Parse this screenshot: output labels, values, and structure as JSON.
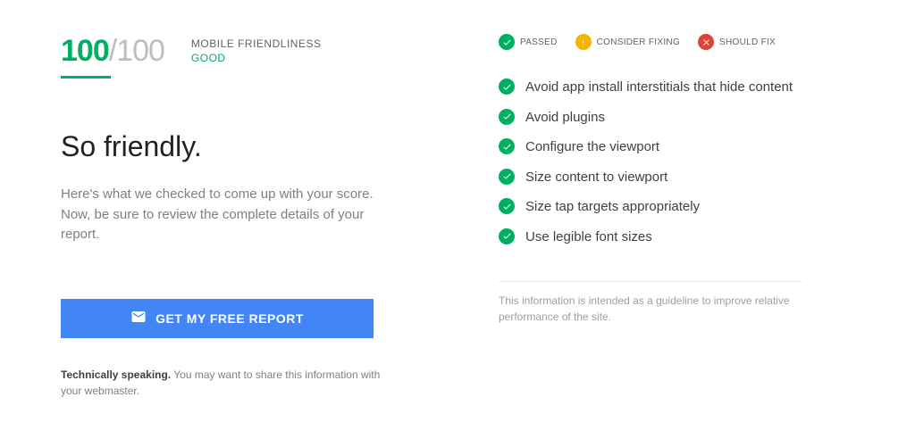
{
  "score": {
    "value": "100",
    "max": "/100",
    "category": "MOBILE FRIENDLINESS",
    "rating": "GOOD"
  },
  "headline": "So friendly.",
  "subtext": "Here's what we checked to come up with your score. Now, be sure to review the complete details of your report.",
  "cta_label": "GET MY FREE REPORT",
  "tech_note": {
    "strong": "Technically speaking.",
    "rest": " You may want to share this information with your webmaster."
  },
  "legend": {
    "passed": "PASSED",
    "consider": "CONSIDER FIXING",
    "should": "SHOULD FIX"
  },
  "checks": [
    {
      "label": "Avoid app install interstitials that hide content"
    },
    {
      "label": "Avoid plugins"
    },
    {
      "label": "Configure the viewport"
    },
    {
      "label": "Size content to viewport"
    },
    {
      "label": "Size tap targets appropriately"
    },
    {
      "label": "Use legible font sizes"
    }
  ],
  "disclaimer": "This information is intended as a guideline to improve relative performance of the site."
}
